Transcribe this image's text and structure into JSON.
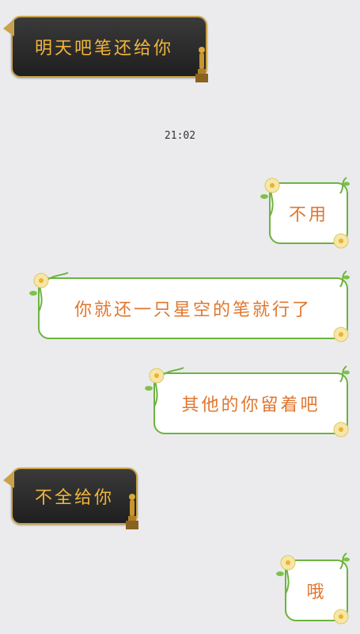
{
  "messages": [
    {
      "side": "left",
      "style": "dark",
      "text": "明天吧笔还给你"
    },
    {
      "side": "right",
      "style": "flower",
      "text": "不用"
    },
    {
      "side": "right",
      "style": "flower",
      "text": "你就还一只星空的笔就行了"
    },
    {
      "side": "right",
      "style": "flower",
      "text": "其他的你留着吧"
    },
    {
      "side": "left",
      "style": "dark",
      "text": "不全给你"
    },
    {
      "side": "right",
      "style": "flower",
      "text": "哦"
    }
  ],
  "timestamp": "21:02",
  "colors": {
    "background": "#ebebed",
    "dark_bubble": "#2a2a2a",
    "gold": "#c8a24a",
    "gold_text": "#f2b63c",
    "green_border": "#6db33f",
    "orange_text": "#e0762e"
  },
  "icons": [
    "trophy-icon",
    "flower-vine-icon"
  ]
}
